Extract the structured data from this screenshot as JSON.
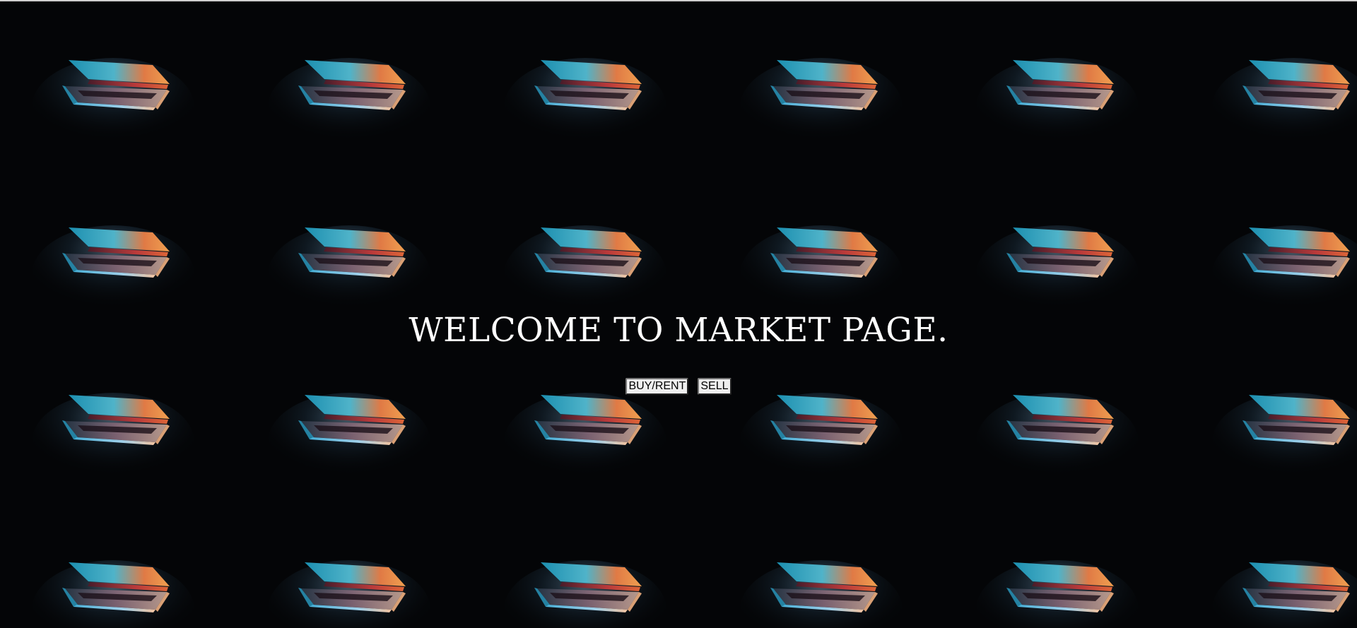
{
  "page": {
    "title": "WELCOME TO MARKET PAGE."
  },
  "actions": {
    "buy_rent_label": "BUY/RENT",
    "sell_label": "SELL"
  },
  "background": {
    "icon": "laptop-photo-tile",
    "base_color": "#040507",
    "glow_colors": [
      "#2bb5d4",
      "#e05a3a",
      "#f29a4a",
      "#8fb8d6"
    ]
  }
}
